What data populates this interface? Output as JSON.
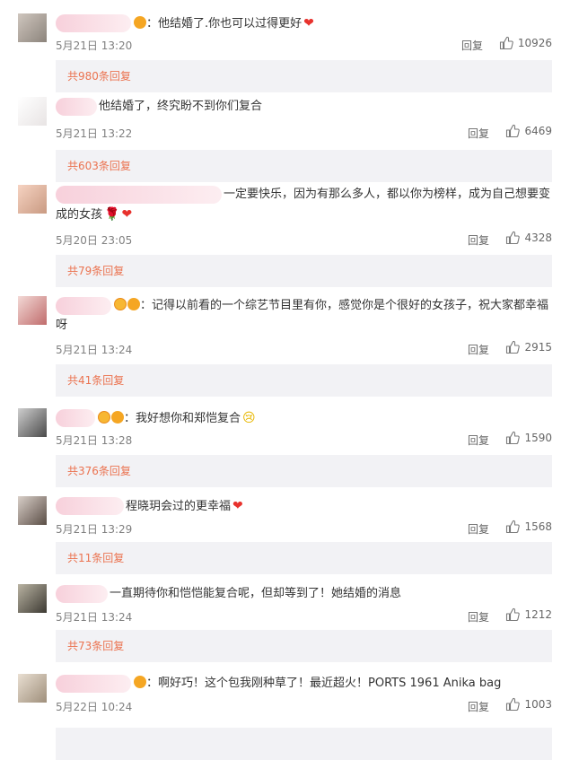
{
  "ui": {
    "reply_label": "回复",
    "reply_icon": "speech-bubble-reply",
    "like_icon": "thumbs-up-icon",
    "reply_link_color": "#eb7350",
    "heart_glyph": "❤",
    "rose_glyph": "🌹",
    "cry_glyph": "😢"
  },
  "comments": [
    {
      "colon": "：",
      "text": "他结婚了.你也可以过得更好",
      "emoji": "heart",
      "date": "5月21日 13:20",
      "likes": "10926",
      "replies_link": "共980条回复",
      "badges": [
        "gold"
      ]
    },
    {
      "colon": "",
      "text": "他结婚了，终究盼不到你们复合",
      "emoji": "",
      "date": "5月21日 13:22",
      "likes": "6469",
      "replies_link": "共603条回复",
      "badges": []
    },
    {
      "colon": "",
      "text": "一定要快乐，因为有那么多人，都以你为榜样，成为自己想要变成的女孩",
      "emoji": "rose-heart",
      "date": "5月20日 23:05",
      "likes": "4328",
      "replies_link": "共79条回复",
      "badges": []
    },
    {
      "colon": "：",
      "text": "记得以前看的一个综艺节目里有你，感觉你是个很好的女孩子，祝大家都幸福呀",
      "emoji": "",
      "date": "5月21日 13:24",
      "likes": "2915",
      "replies_link": "共41条回复",
      "badges": [
        "vip",
        "gold"
      ]
    },
    {
      "colon": "：",
      "text": "我好想你和郑恺复合",
      "emoji": "cry",
      "date": "5月21日 13:28",
      "likes": "1590",
      "replies_link": "共376条回复",
      "badges": [
        "vip",
        "gold"
      ]
    },
    {
      "colon": "",
      "text": "程晓玥会过的更幸福",
      "emoji": "heart",
      "date": "5月21日 13:29",
      "likes": "1568",
      "replies_link": "共11条回复",
      "badges": []
    },
    {
      "colon": "",
      "text": "一直期待你和恺恺能复合呢，但却等到了！她结婚的消息",
      "emoji": "",
      "date": "5月21日 13:24",
      "likes": "1212",
      "replies_link": "共73条回复",
      "badges": []
    },
    {
      "colon": "：",
      "text": "啊好巧！这个包我刚种草了！最近超火！PORTS 1961 Anika bag",
      "emoji": "",
      "date": "5月22日 10:24",
      "likes": "1003",
      "replies_link": "",
      "badges": [
        "gold"
      ]
    }
  ]
}
